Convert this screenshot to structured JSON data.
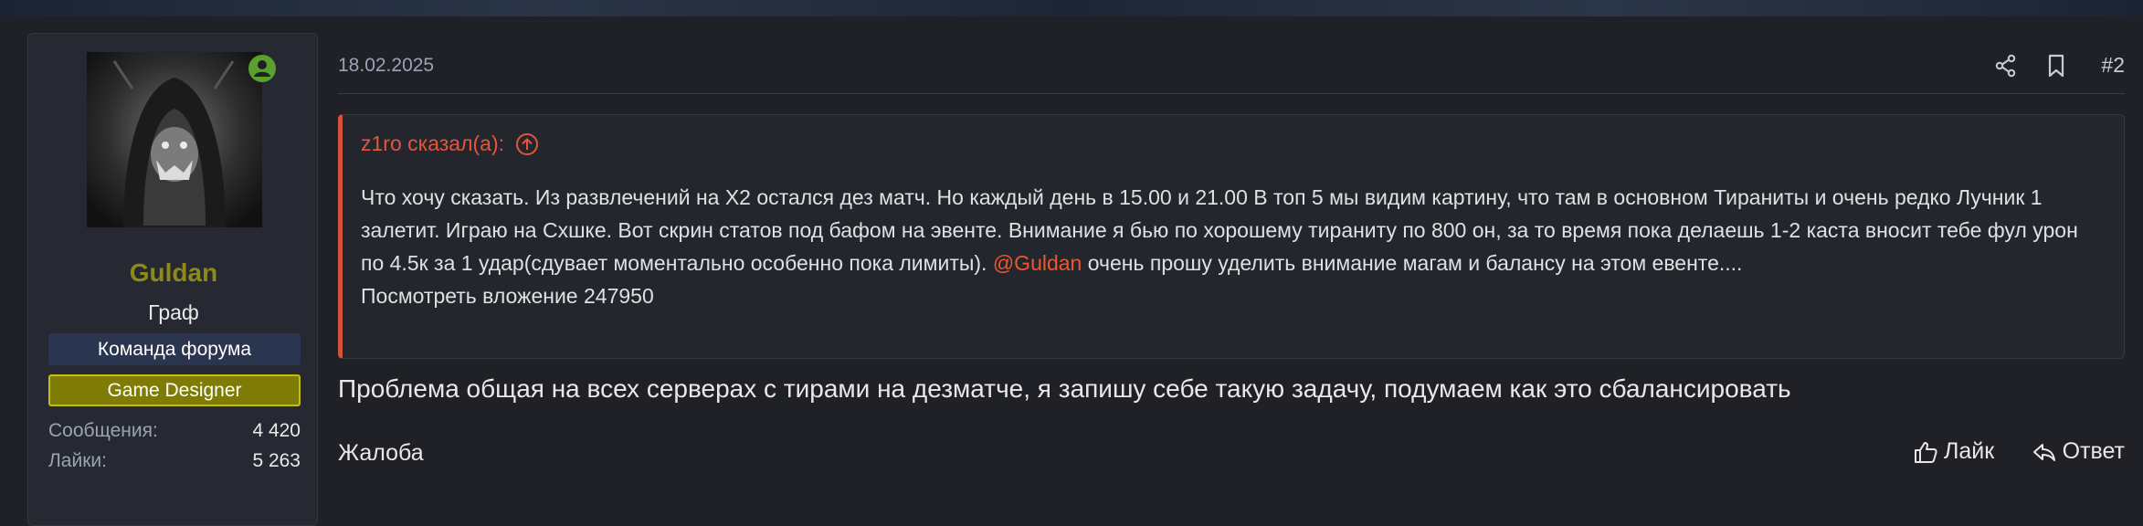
{
  "user": {
    "name": "Guldan",
    "title": "Граф",
    "banners": [
      "Команда форума",
      "Game Designer"
    ],
    "stats": {
      "messages_label": "Сообщения:",
      "messages_value": "4 420",
      "likes_label": "Лайки:",
      "likes_value": "5 263"
    },
    "online": true
  },
  "post": {
    "date": "18.02.2025",
    "number": "#2",
    "quote": {
      "author_line": "z1ro сказал(а):",
      "body_part1": "Что хочу сказать. Из развлечений на Х2 остался дез матч. Но каждый день в 15.00 и 21.00 В топ 5 мы видим картину, что там в основном Тираниты и очень редко Лучник 1 залетит. Играю на Схшке. Вот скрин статов под бафом на эвенте. Внимание я бью по хорошему тираниту по 800 он, за то время пока делаешь 1-2 каста вносит тебе фул урон по 4.5к за 1 удар(сдувает моментально особенно пока лимиты).",
      "mention": "@Guldan",
      "body_part2": "очень прошу уделить внимание магам и балансу на этом евенте....",
      "attachment": "Посмотреть вложение 247950"
    },
    "text": "Проблема общая на всех серверах с тирами на дезматче, я запишу себе такую задачу, подумаем как это сбалансировать",
    "footer": {
      "report": "Жалоба",
      "like": "Лайк",
      "reply": "Ответ"
    }
  },
  "colors": {
    "accent_red": "#e4553a",
    "username": "#8d8a19",
    "online_badge": "#5aa02c"
  }
}
